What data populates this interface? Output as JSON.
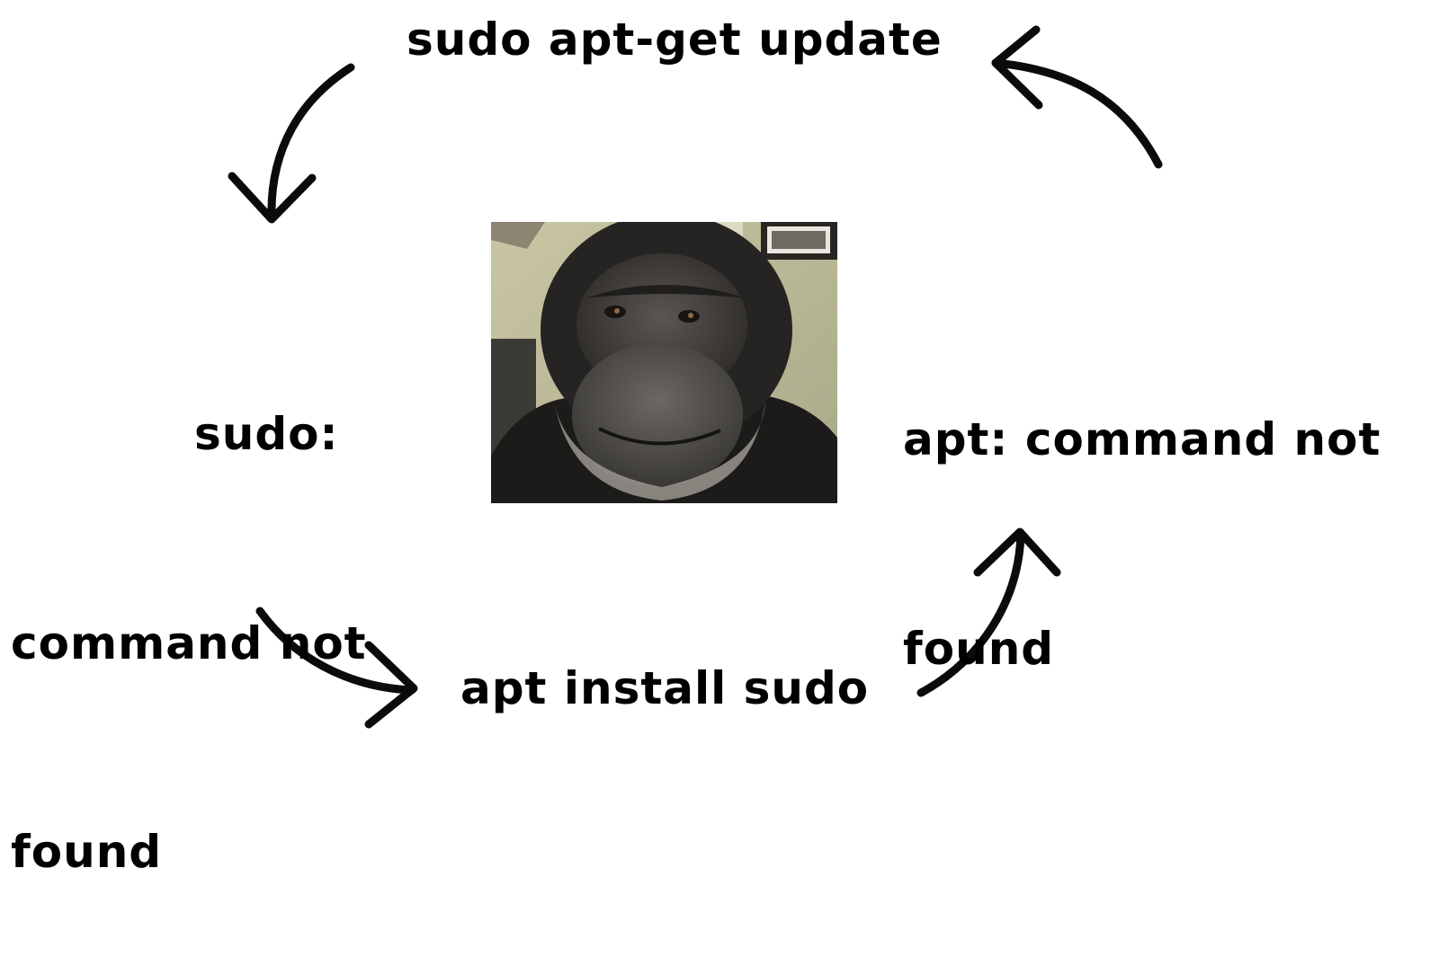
{
  "diagram": {
    "nodes": {
      "top": "sudo apt-get update",
      "left_line1": "sudo:",
      "left_line2": "command not",
      "left_line3": "found",
      "right_line1": "apt: command not",
      "right_line2": "found",
      "bottom": "apt install sudo"
    },
    "center_image": "chimpanzee-photo",
    "edges": [
      {
        "from": "sudo apt-get update",
        "to": "sudo: command not found"
      },
      {
        "from": "sudo: command not found",
        "to": "apt install sudo"
      },
      {
        "from": "apt install sudo",
        "to": "apt: command not found"
      },
      {
        "from": "apt: command not found",
        "to": "sudo apt-get update"
      }
    ],
    "colors": {
      "ink": "#000000",
      "background": "#ffffff"
    }
  }
}
